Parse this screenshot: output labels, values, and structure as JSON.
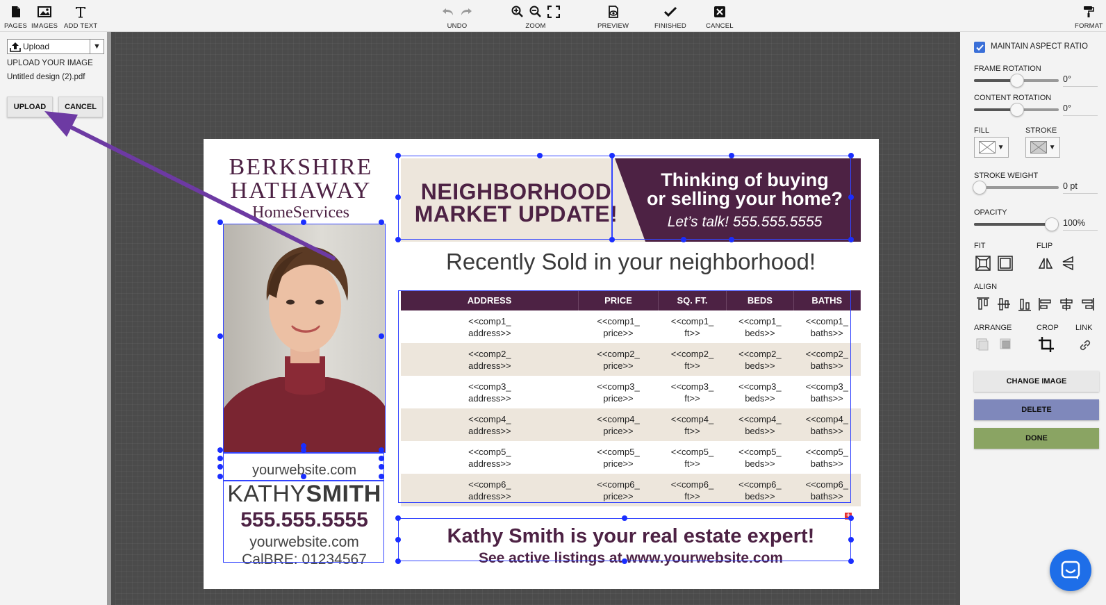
{
  "toolbar": {
    "pages": "PAGES",
    "images": "IMAGES",
    "add_text": "ADD TEXT",
    "undo": "UNDO",
    "zoom": "ZOOM",
    "preview": "PREVIEW",
    "finished": "FINISHED",
    "cancel": "CANCEL",
    "format": "FORMAT"
  },
  "left_panel": {
    "select_value": "Upload",
    "upload_title": "UPLOAD YOUR IMAGE",
    "file_name": "Untitled design (2).pdf",
    "upload_button": "UPLOAD",
    "cancel_button": "CANCEL"
  },
  "flyer": {
    "logo": {
      "line1": "BERKSHIRE",
      "line2": "HATHAWAY",
      "line3": "HomeServices"
    },
    "banner": {
      "title_line1": "NEIGHBORHOOD",
      "title_line2": "MARKET UPDATE!",
      "cta_line1": "Thinking of buying",
      "cta_line2": "or selling your home?",
      "talk": "Let’s talk! 555.555.5555"
    },
    "recent_heading": "Recently Sold in your neighborhood!",
    "table": {
      "headers": [
        "ADDRESS",
        "PRICE",
        "SQ. FT.",
        "BEDS",
        "BATHS"
      ],
      "rows": [
        [
          [
            "<<comp1_",
            "address>>"
          ],
          [
            "<<comp1_",
            "price>>"
          ],
          [
            "<<comp1_",
            "ft>>"
          ],
          [
            "<<comp1_",
            "beds>>"
          ],
          [
            "<<comp1_",
            "baths>>"
          ]
        ],
        [
          [
            "<<comp2_",
            "address>>"
          ],
          [
            "<<comp2_",
            "price>>"
          ],
          [
            "<<comp2_",
            "ft>>"
          ],
          [
            "<<comp2_",
            "beds>>"
          ],
          [
            "<<comp2_",
            "baths>>"
          ]
        ],
        [
          [
            "<<comp3_",
            "address>>"
          ],
          [
            "<<comp3_",
            "price>>"
          ],
          [
            "<<comp3_",
            "ft>>"
          ],
          [
            "<<comp3_",
            "beds>>"
          ],
          [
            "<<comp3_",
            "baths>>"
          ]
        ],
        [
          [
            "<<comp4_",
            "address>>"
          ],
          [
            "<<comp4_",
            "price>>"
          ],
          [
            "<<comp4_",
            "ft>>"
          ],
          [
            "<<comp4_",
            "beds>>"
          ],
          [
            "<<comp4_",
            "baths>>"
          ]
        ],
        [
          [
            "<<comp5_",
            "address>>"
          ],
          [
            "<<comp5_",
            "price>>"
          ],
          [
            "<<comp5_",
            "ft>>"
          ],
          [
            "<<comp5_",
            "beds>>"
          ],
          [
            "<<comp5_",
            "baths>>"
          ]
        ],
        [
          [
            "<<comp6_",
            "address>>"
          ],
          [
            "<<comp6_",
            "price>>"
          ],
          [
            "<<comp6_",
            "ft>>"
          ],
          [
            "<<comp6_",
            "beds>>"
          ],
          [
            "<<comp6_",
            "baths>>"
          ]
        ]
      ]
    },
    "agent": {
      "website_top": "yourwebsite.com",
      "first_name": "KATHY",
      "last_name": "SMITH",
      "phone": "555.555.5555",
      "website": "yourwebsite.com",
      "license": "CalBRE: 01234567"
    },
    "footer": {
      "line1": "Kathy Smith is your real estate expert!",
      "line2": "See active listings at www.yourwebsite.com"
    }
  },
  "right_panel": {
    "maintain_aspect": "MAINTAIN ASPECT RATIO",
    "maintain_aspect_checked": true,
    "frame_rotation": "FRAME ROTATION",
    "frame_rotation_value": "0°",
    "content_rotation": "CONTENT ROTATION",
    "content_rotation_value": "0°",
    "fill": "FILL",
    "stroke": "STROKE",
    "stroke_weight": "STROKE WEIGHT",
    "stroke_weight_value": "0 pt",
    "opacity": "OPACITY",
    "opacity_value": "100%",
    "fit": "FIT",
    "flip": "FLIP",
    "align": "ALIGN",
    "arrange": "ARRANGE",
    "crop": "CROP",
    "link": "LINK",
    "change_image": "CHANGE IMAGE",
    "delete": "DELETE",
    "done": "DONE"
  },
  "colors": {
    "brand_purple": "#4d2244",
    "banner_beige": "#ede6dc",
    "selection_blue": "#1a2eff",
    "delete_button": "#7f88bb",
    "done_button": "#8aa463",
    "annotation_arrow": "#6d3aa3"
  }
}
